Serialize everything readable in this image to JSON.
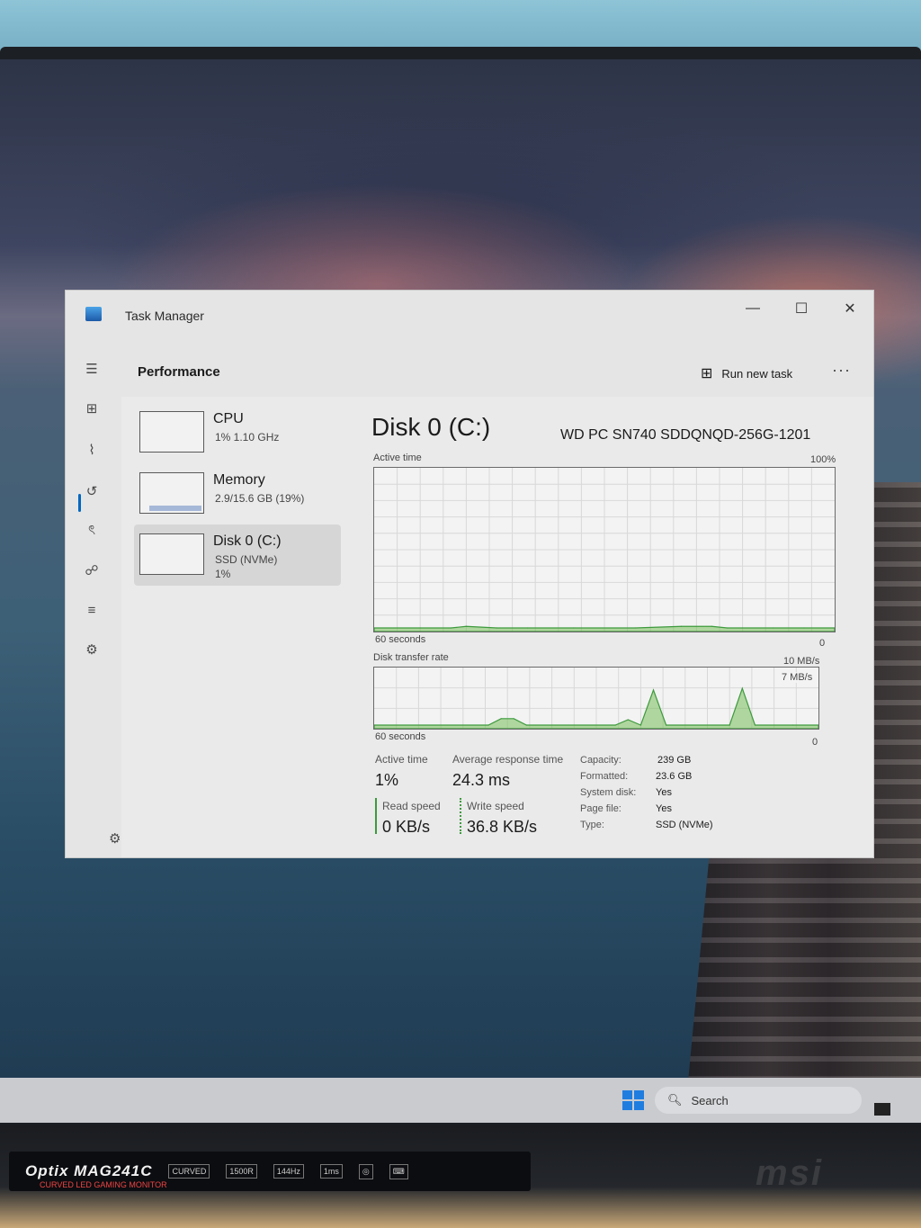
{
  "window": {
    "title": "Task Manager",
    "minimize": "—",
    "maximize": "☐",
    "close": "✕"
  },
  "header": {
    "page_title": "Performance",
    "run_new_task": "Run new task",
    "more": "···"
  },
  "nav": [
    {
      "name": "hamburger-menu-icon",
      "glyph": "☰"
    },
    {
      "name": "processes-icon",
      "glyph": "⊞"
    },
    {
      "name": "performance-icon",
      "glyph": "⌇"
    },
    {
      "name": "app-history-icon",
      "glyph": "↺"
    },
    {
      "name": "startup-apps-icon",
      "glyph": "ৎ"
    },
    {
      "name": "users-icon",
      "glyph": "☍"
    },
    {
      "name": "details-icon",
      "glyph": "≡"
    },
    {
      "name": "services-icon",
      "glyph": "⚙"
    }
  ],
  "settings_glyph": "⚙",
  "devices": [
    {
      "name": "CPU",
      "sub": "1% 1.10 GHz",
      "sub2": ""
    },
    {
      "name": "Memory",
      "sub": "2.9/15.6 GB (19%)",
      "sub2": ""
    },
    {
      "name": "Disk 0 (C:)",
      "sub": "SSD (NVMe)",
      "sub2": "1%"
    }
  ],
  "disk": {
    "title": "Disk 0 (C:)",
    "model": "WD PC SN740 SDDQNQD-256G-1201"
  },
  "charts": {
    "active_time_label": "Active time",
    "active_time_max": "100%",
    "active_time_duration": "60 seconds",
    "active_time_min": "0",
    "transfer_label": "Disk transfer rate",
    "transfer_max": "10 MB/s",
    "transfer_marker": "7 MB/s",
    "transfer_duration": "60 seconds",
    "transfer_min": "0"
  },
  "stats": {
    "active_time_label": "Active time",
    "active_time_value": "1%",
    "response_label": "Average response time",
    "response_value": "24.3 ms",
    "read_label": "Read speed",
    "read_value": "0 KB/s",
    "write_label": "Write speed",
    "write_value": "36.8 KB/s"
  },
  "properties": {
    "capacity_k": "Capacity:",
    "capacity_v": "239 GB",
    "formatted_k": "Formatted:",
    "formatted_v": "23.6 GB",
    "system_k": "System disk:",
    "system_v": "Yes",
    "pagefile_k": "Page file:",
    "pagefile_v": "Yes",
    "type_k": "Type:",
    "type_v": "SSD (NVMe)"
  },
  "taskbar": {
    "search_placeholder": "Search"
  },
  "monitor": {
    "brand_title": "Optix MAG241C",
    "brand_sub": "CURVED LED GAMING MONITOR",
    "badges": [
      "CURVED",
      "1500R",
      "144Hz",
      "1ms",
      "◎",
      "⌨"
    ],
    "maker": "msi"
  },
  "chart_data": [
    {
      "type": "area",
      "title": "Active time",
      "ylim": [
        0,
        100
      ],
      "x": [
        0,
        6,
        10,
        12,
        16,
        20,
        26,
        34,
        40,
        44,
        46,
        48,
        52,
        56,
        60
      ],
      "series": [
        {
          "values": [
            0,
            0,
            0,
            1,
            0,
            0,
            0,
            0,
            1,
            1,
            0,
            0,
            0,
            0,
            0
          ]
        }
      ],
      "grid": true
    },
    {
      "type": "area",
      "title": "Disk transfer rate",
      "ylim": [
        0,
        10
      ],
      "x": [
        0,
        18,
        20,
        22,
        24,
        38,
        40,
        42,
        44,
        46,
        56,
        58,
        60,
        66,
        70
      ],
      "series": [
        {
          "values": [
            0,
            0,
            1.2,
            1.2,
            0,
            0,
            1.0,
            0,
            6.5,
            0,
            0,
            6.8,
            0,
            0,
            0
          ]
        }
      ],
      "grid": true
    }
  ]
}
